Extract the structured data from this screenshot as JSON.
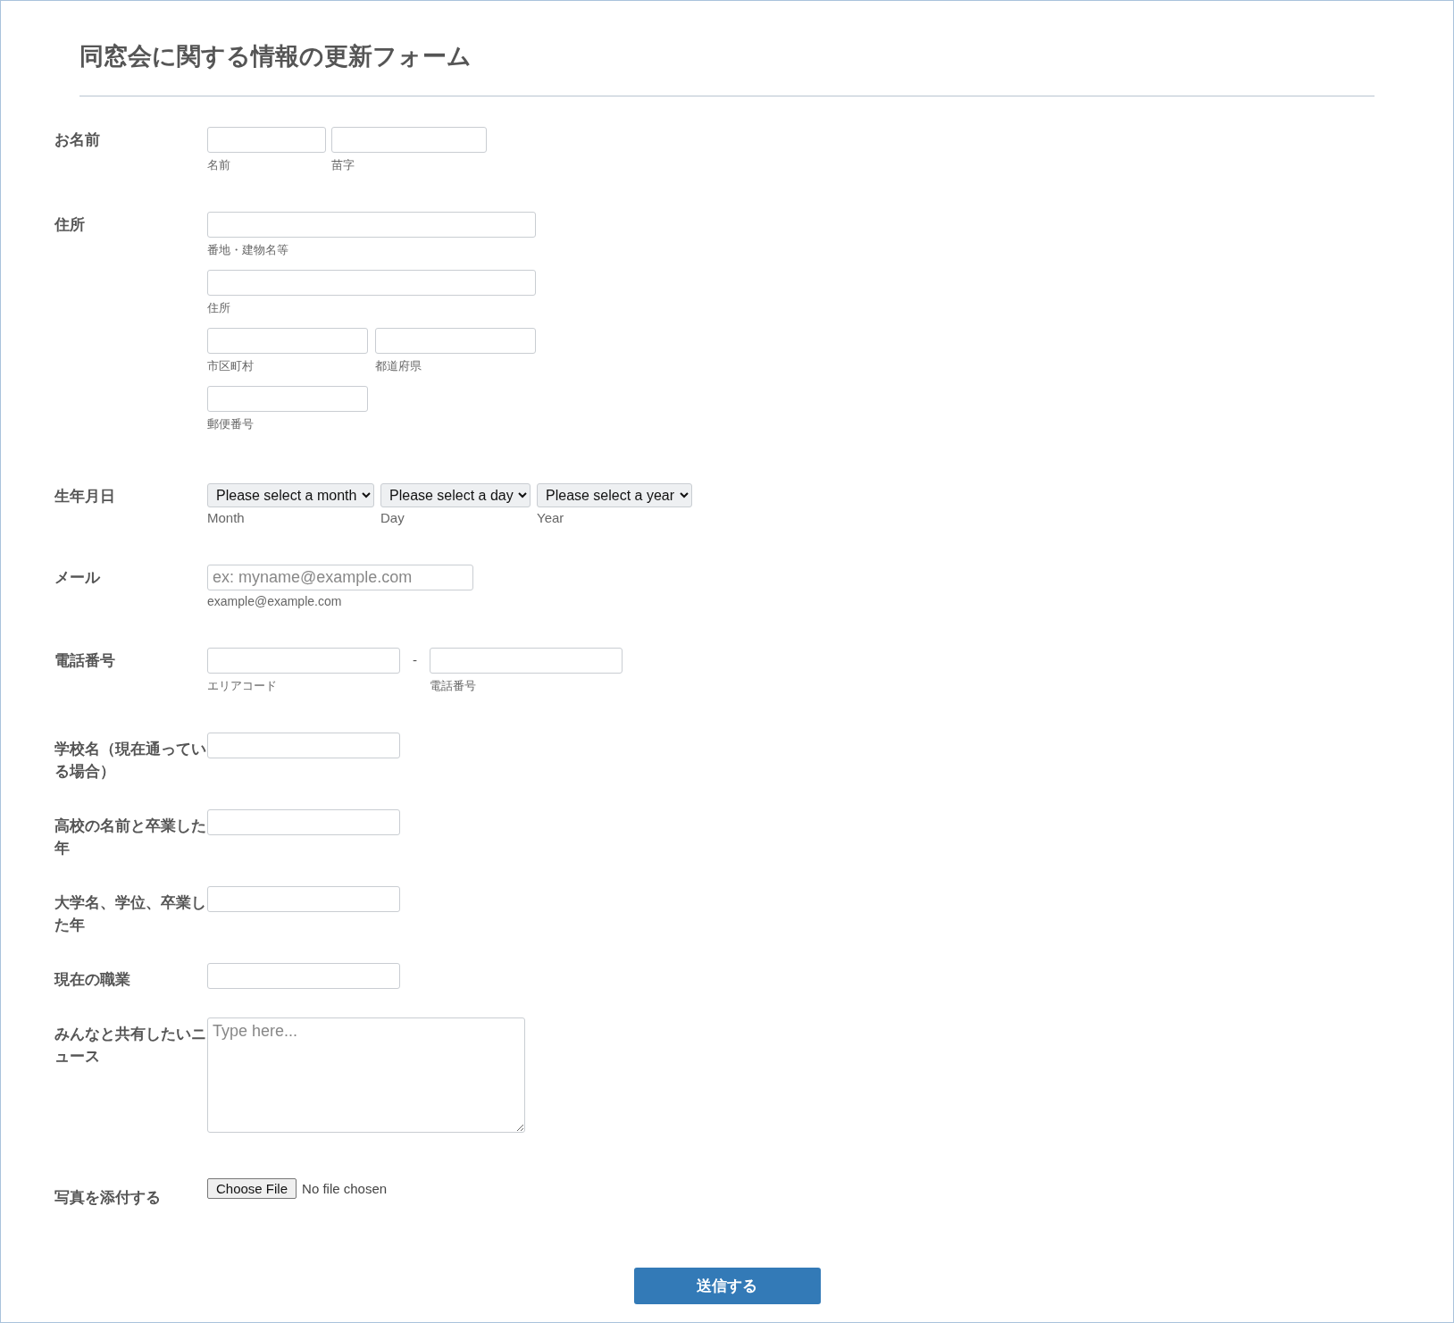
{
  "form": {
    "title": "同窓会に関する情報の更新フォーム",
    "fields": [
      {
        "kind": "name",
        "label": "お名前",
        "inputs": [
          {
            "sublabel": "名前"
          },
          {
            "sublabel": "苗字"
          }
        ]
      },
      {
        "kind": "address",
        "label": "住所",
        "inputs": [
          {
            "sublabel": "番地・建物名等"
          },
          {
            "sublabel": "住所"
          },
          {
            "sublabel": "市区町村"
          },
          {
            "sublabel": "都道府県"
          },
          {
            "sublabel": "郵便番号"
          }
        ]
      },
      {
        "kind": "date",
        "label": "生年月日",
        "selects": [
          {
            "value": "Please select a month",
            "sublabel": "Month"
          },
          {
            "value": "Please select a day",
            "sublabel": "Day"
          },
          {
            "value": "Please select a year",
            "sublabel": "Year"
          }
        ]
      },
      {
        "kind": "email",
        "label": "メール",
        "placeholder": "ex: myname@example.com",
        "sublabel": "example@example.com"
      },
      {
        "kind": "phone",
        "label": "電話番号",
        "separator": "-",
        "inputs": [
          {
            "sublabel": "エリアコード"
          },
          {
            "sublabel": "電話番号"
          }
        ]
      },
      {
        "kind": "text",
        "label": "学校名（現在通っている場合）"
      },
      {
        "kind": "text",
        "label": "高校の名前と卒業した年"
      },
      {
        "kind": "text",
        "label": "大学名、学位、卒業した年"
      },
      {
        "kind": "text",
        "label": "現在の職業"
      },
      {
        "kind": "textarea",
        "label": "みんなと共有したいニュース",
        "placeholder": "Type here..."
      },
      {
        "kind": "file",
        "label": "写真を添付する",
        "button": "Choose File",
        "status": "No file chosen"
      }
    ],
    "submit": "送信する"
  }
}
